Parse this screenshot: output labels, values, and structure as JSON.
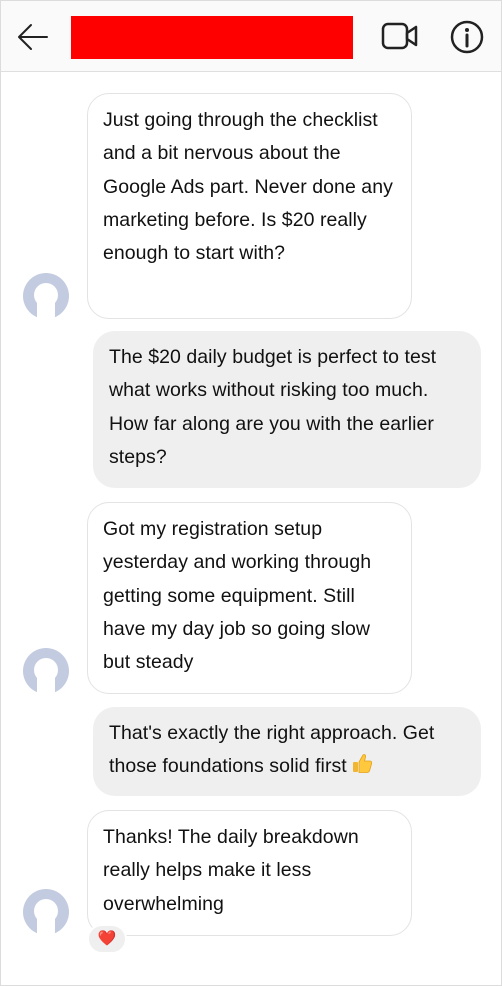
{
  "header": {
    "back_icon": "arrow-left-icon",
    "video_icon": "video-camera-icon",
    "info_icon": "info-circle-icon"
  },
  "messages": [
    {
      "sender": "contact",
      "text": "Just going through the checklist and a bit nervous about the Google Ads part. Never done any marketing before. Is $20 really enough to start with?"
    },
    {
      "sender": "me",
      "text": "The $20 daily budget is perfect to test what works without risking too much. How far along are you with the earlier steps?"
    },
    {
      "sender": "contact",
      "text": "Got my registration setup yesterday and working through getting some equipment. Still have my day job so going slow but steady"
    },
    {
      "sender": "me",
      "text": "That's exactly the right approach. Get those foundations solid first",
      "emoji": "thumbs-up-icon"
    },
    {
      "sender": "contact",
      "text": "Thanks! The daily breakdown really helps make it less overwhelming",
      "reaction": "❤️"
    }
  ],
  "colors": {
    "incoming_bubble": "#ffffff",
    "outgoing_bubble": "#efefef",
    "redaction": "#ff0000",
    "avatar": "#c3cbe0"
  }
}
